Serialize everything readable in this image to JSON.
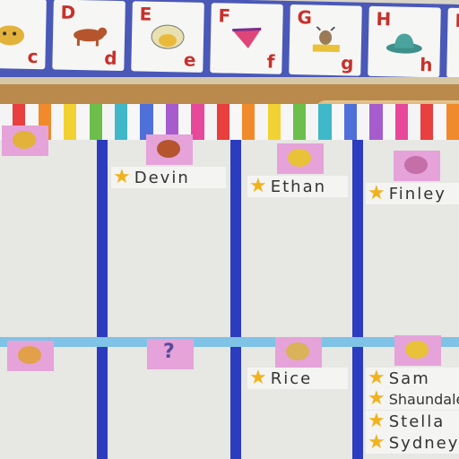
{
  "alphabet_cards": [
    {
      "upper": "",
      "lower": "c",
      "picture": "cat-icon"
    },
    {
      "upper": "D",
      "lower": "d",
      "picture": "dog-icon"
    },
    {
      "upper": "E",
      "lower": "e",
      "picture": "egg-icon"
    },
    {
      "upper": "F",
      "lower": "f",
      "picture": "fan-icon"
    },
    {
      "upper": "G",
      "lower": "g",
      "picture": "goat-icon"
    },
    {
      "upper": "H",
      "lower": "h",
      "picture": "hat-icon"
    },
    {
      "upper": "I",
      "lower": "",
      "picture": "igloo-icon"
    }
  ],
  "pocket_chart": {
    "top_row": [
      {
        "name": "Devin"
      },
      {
        "name": "Ethan"
      },
      {
        "name": "Finley"
      }
    ],
    "bottom_row": {
      "question_mark": "?",
      "names": [
        "Rice",
        "Sam",
        "Shaundale",
        "Stella",
        "Sydney"
      ]
    }
  },
  "colors": {
    "strip_blue": "#4a58b8",
    "divider_blue": "#2c3cc0",
    "letter_red": "#c8302b",
    "tag_pink": "#e5a3d9",
    "star_gold": "#f2b21c",
    "rail_light_blue": "#7fc3e6"
  }
}
